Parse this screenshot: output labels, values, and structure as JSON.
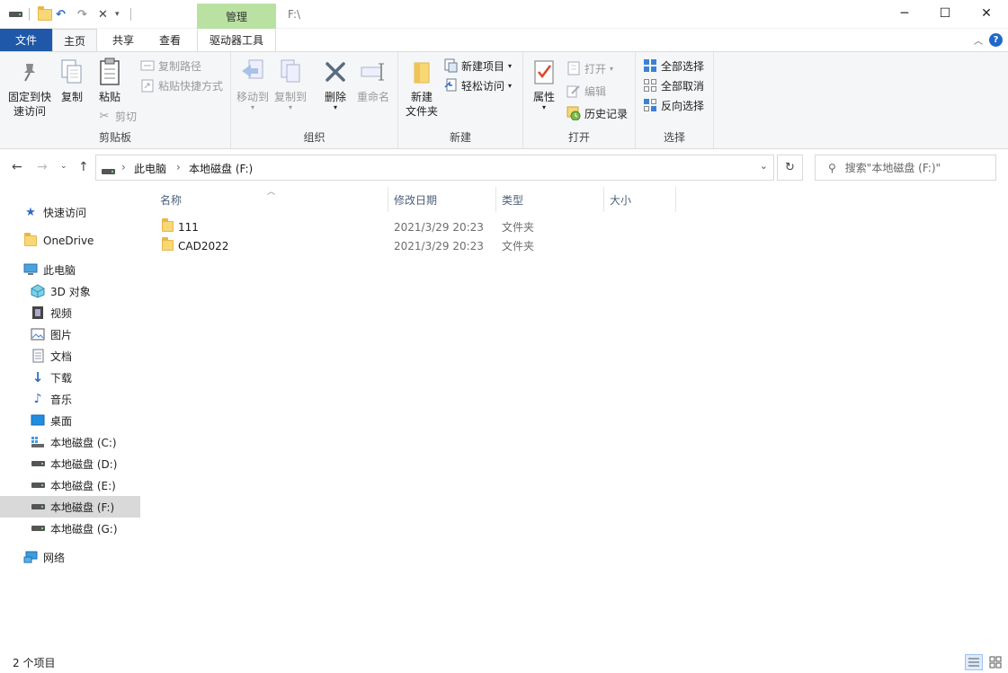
{
  "titlebar": {
    "manage_tab": "管理",
    "path": "F:\\",
    "minimize": "─",
    "maximize": "☐",
    "close": "✕"
  },
  "tabs": {
    "file": "文件",
    "home": "主页",
    "share": "共享",
    "view": "查看",
    "drive_tools": "驱动器工具",
    "help": "?"
  },
  "ribbon": {
    "clipboard": {
      "label": "剪贴板",
      "pin": "固定到快\n速访问",
      "pin_line1": "固定到快",
      "pin_line2": "速访问",
      "copy": "复制",
      "paste": "粘贴",
      "copy_path": "复制路径",
      "paste_shortcut": "粘贴快捷方式",
      "cut": "剪切"
    },
    "organize": {
      "label": "组织",
      "move_to": "移动到",
      "copy_to": "复制到",
      "delete": "删除",
      "rename": "重命名"
    },
    "new": {
      "label": "新建",
      "new_folder_line1": "新建",
      "new_folder_line2": "文件夹",
      "new_item": "新建项目",
      "easy_access": "轻松访问"
    },
    "open": {
      "label": "打开",
      "properties": "属性",
      "open": "打开",
      "edit": "编辑",
      "history": "历史记录"
    },
    "select": {
      "label": "选择",
      "select_all": "全部选择",
      "select_none": "全部取消",
      "invert": "反向选择"
    }
  },
  "address": {
    "crumbs": [
      "此电脑",
      "本地磁盘 (F:)"
    ],
    "search_placeholder": "搜索\"本地磁盘 (F:)\""
  },
  "nav": {
    "quick_access": "快速访问",
    "onedrive": "OneDrive",
    "this_pc": "此电脑",
    "objects3d": "3D 对象",
    "videos": "视频",
    "pictures": "图片",
    "documents": "文档",
    "downloads": "下载",
    "music": "音乐",
    "desktop": "桌面",
    "drive_c": "本地磁盘 (C:)",
    "drive_d": "本地磁盘 (D:)",
    "drive_e": "本地磁盘 (E:)",
    "drive_f": "本地磁盘 (F:)",
    "drive_g": "本地磁盘 (G:)",
    "network": "网络"
  },
  "columns": {
    "name": "名称",
    "modified": "修改日期",
    "type": "类型",
    "size": "大小"
  },
  "files": [
    {
      "name": "111",
      "modified": "2021/3/29 20:23",
      "type": "文件夹"
    },
    {
      "name": "CAD2022",
      "modified": "2021/3/29 20:23",
      "type": "文件夹"
    }
  ],
  "status": {
    "count": "2 个项目"
  }
}
